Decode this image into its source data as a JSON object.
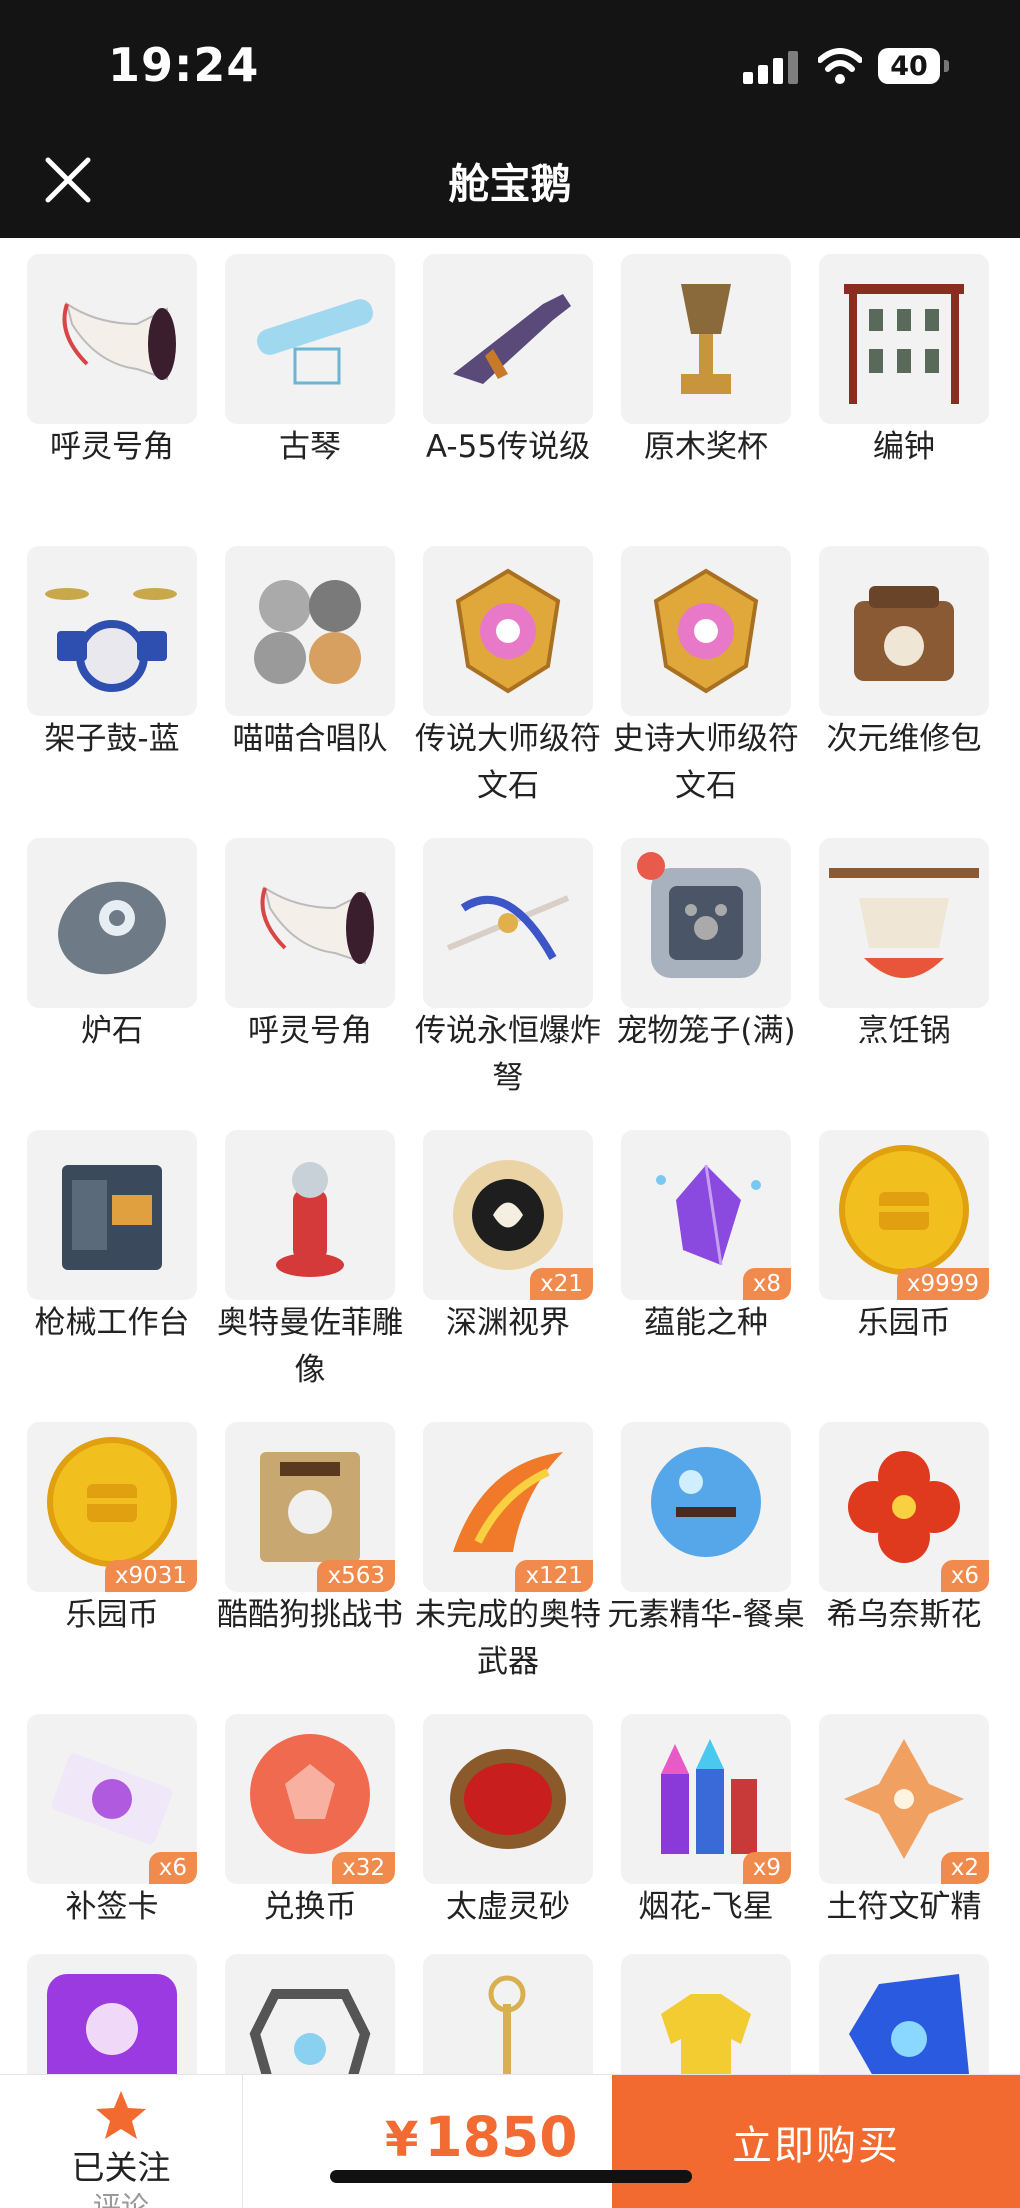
{
  "status_bar": {
    "time": "19:24",
    "battery": "40"
  },
  "header": {
    "title": "舱宝鹅"
  },
  "items": [
    {
      "name": "呼灵号角",
      "qty": "",
      "icon": "horn-icon",
      "color": "#d84545"
    },
    {
      "name": "古琴",
      "qty": "",
      "icon": "guqin-icon",
      "color": "#9fd8ef"
    },
    {
      "name": "A-55传说级",
      "qty": "",
      "icon": "rifle-icon",
      "color": "#5a4a7a"
    },
    {
      "name": "原木奖杯",
      "qty": "",
      "icon": "trophy-icon",
      "color": "#c8953c"
    },
    {
      "name": "编钟",
      "qty": "",
      "icon": "chime-bells-icon",
      "color": "#8b2c20"
    },
    {
      "name": "架子鼓-蓝",
      "qty": "",
      "icon": "drum-kit-icon",
      "color": "#2f4fb0"
    },
    {
      "name": "喵喵合唱队",
      "qty": "",
      "icon": "cats-icon",
      "color": "#9a9a9a"
    },
    {
      "name": "传说大师级符文石",
      "qty": "",
      "icon": "rune-stone-icon",
      "color": "#e0a83a"
    },
    {
      "name": "史诗大师级符文石",
      "qty": "",
      "icon": "rune-stone-icon",
      "color": "#e0a83a"
    },
    {
      "name": "次元维修包",
      "qty": "",
      "icon": "repair-bag-icon",
      "color": "#8a5a34"
    },
    {
      "name": "炉石",
      "qty": "",
      "icon": "hearthstone-icon",
      "color": "#6e7a86"
    },
    {
      "name": "呼灵号角",
      "qty": "",
      "icon": "horn-icon",
      "color": "#d84545"
    },
    {
      "name": "传说永恒爆炸弩",
      "qty": "",
      "icon": "crossbow-icon",
      "color": "#3c56c8"
    },
    {
      "name": "宠物笼子(满)",
      "qty": "",
      "icon": "pet-cage-icon",
      "color": "#4a5568"
    },
    {
      "name": "烹饪锅",
      "qty": "",
      "icon": "cooking-pot-icon",
      "color": "#e8553a"
    },
    {
      "name": "枪械工作台",
      "qty": "",
      "icon": "workbench-icon",
      "color": "#3a4a5c"
    },
    {
      "name": "奥特曼佐菲雕像",
      "qty": "",
      "icon": "statue-icon",
      "color": "#d43a3a"
    },
    {
      "name": "深渊视界",
      "qty": "x21",
      "icon": "abyss-eye-icon",
      "color": "#e0b04a"
    },
    {
      "name": "蕴能之种",
      "qty": "x8",
      "icon": "crystal-icon",
      "color": "#8a4ae0"
    },
    {
      "name": "乐园币",
      "qty": "x9999",
      "icon": "coin-icon",
      "color": "#f2c01e"
    },
    {
      "name": "乐园币",
      "qty": "x9031",
      "icon": "coin-icon",
      "color": "#f2c01e"
    },
    {
      "name": "酷酷狗挑战书",
      "qty": "x563",
      "icon": "wanted-scroll-icon",
      "color": "#c8a870"
    },
    {
      "name": "未完成的奥特武器",
      "qty": "x121",
      "icon": "flame-blade-icon",
      "color": "#f07a2a"
    },
    {
      "name": "元素精华-餐桌",
      "qty": "",
      "icon": "orb-icon",
      "color": "#3a9ae8"
    },
    {
      "name": "希乌奈斯花",
      "qty": "x6",
      "icon": "flower-icon",
      "color": "#e03a1e"
    },
    {
      "name": "补签卡",
      "qty": "x6",
      "icon": "ticket-icon",
      "color": "#b05ae0"
    },
    {
      "name": "兑换币",
      "qty": "x32",
      "icon": "exchange-coin-icon",
      "color": "#f06a50"
    },
    {
      "name": "太虚灵砂",
      "qty": "",
      "icon": "red-gem-icon",
      "color": "#c81e1e"
    },
    {
      "name": "烟花-飞星",
      "qty": "x9",
      "icon": "firework-icon",
      "color": "#8a3ad8"
    },
    {
      "name": "土符文矿精",
      "qty": "x2",
      "icon": "ore-crystal-icon",
      "color": "#f0a060"
    },
    {
      "name": "",
      "qty": "",
      "icon": "octopus-gem-icon",
      "color": "#9a3ae0"
    },
    {
      "name": "",
      "qty": "",
      "icon": "cage-cube-icon",
      "color": "#555555"
    },
    {
      "name": "",
      "qty": "",
      "icon": "wand-icon",
      "color": "#d8b050"
    },
    {
      "name": "",
      "qty": "",
      "icon": "tshirt-icon",
      "color": "#f2cc30"
    },
    {
      "name": "",
      "qty": "",
      "icon": "blue-gem-icon",
      "color": "#2a5ae0"
    }
  ],
  "bottom_bar": {
    "follow_label": "已关注",
    "follow_sub": "评论",
    "price_symbol": "¥",
    "price_value": "1850",
    "buy_label": "立即购买"
  },
  "colors": {
    "accent": "#f26a2f",
    "badge": "#f08a4d",
    "topbar": "#141414"
  }
}
